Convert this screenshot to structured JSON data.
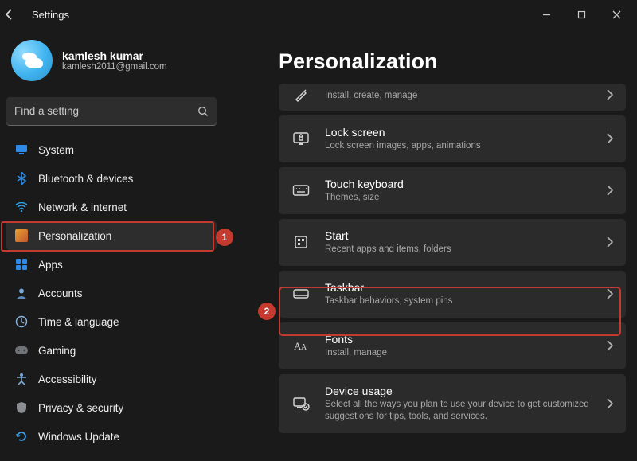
{
  "titlebar": {
    "title": "Settings"
  },
  "profile": {
    "name": "kamlesh kumar",
    "email": "kamlesh2011@gmail.com"
  },
  "search": {
    "placeholder": "Find a setting"
  },
  "nav": [
    {
      "label": "System",
      "icon": "system"
    },
    {
      "label": "Bluetooth & devices",
      "icon": "bluetooth"
    },
    {
      "label": "Network & internet",
      "icon": "network"
    },
    {
      "label": "Personalization",
      "icon": "personalization",
      "active": true
    },
    {
      "label": "Apps",
      "icon": "apps"
    },
    {
      "label": "Accounts",
      "icon": "accounts"
    },
    {
      "label": "Time & language",
      "icon": "time"
    },
    {
      "label": "Gaming",
      "icon": "gaming"
    },
    {
      "label": "Accessibility",
      "icon": "accessibility"
    },
    {
      "label": "Privacy & security",
      "icon": "privacy"
    },
    {
      "label": "Windows Update",
      "icon": "update"
    }
  ],
  "main": {
    "heading": "Personalization",
    "cards": [
      {
        "title": "",
        "subtitle": "Install, create, manage",
        "icon": "pen",
        "partial": true
      },
      {
        "title": "Lock screen",
        "subtitle": "Lock screen images, apps, animations",
        "icon": "lockscreen"
      },
      {
        "title": "Touch keyboard",
        "subtitle": "Themes, size",
        "icon": "keyboard"
      },
      {
        "title": "Start",
        "subtitle": "Recent apps and items, folders",
        "icon": "start"
      },
      {
        "title": "Taskbar",
        "subtitle": "Taskbar behaviors, system pins",
        "icon": "taskbar"
      },
      {
        "title": "Fonts",
        "subtitle": "Install, manage",
        "icon": "fonts"
      },
      {
        "title": "Device usage",
        "subtitle": "Select all the ways you plan to use your device to get customized suggestions for tips, tools, and services.",
        "icon": "device-usage"
      }
    ]
  },
  "annotations": {
    "badge1": "1",
    "badge2": "2"
  }
}
